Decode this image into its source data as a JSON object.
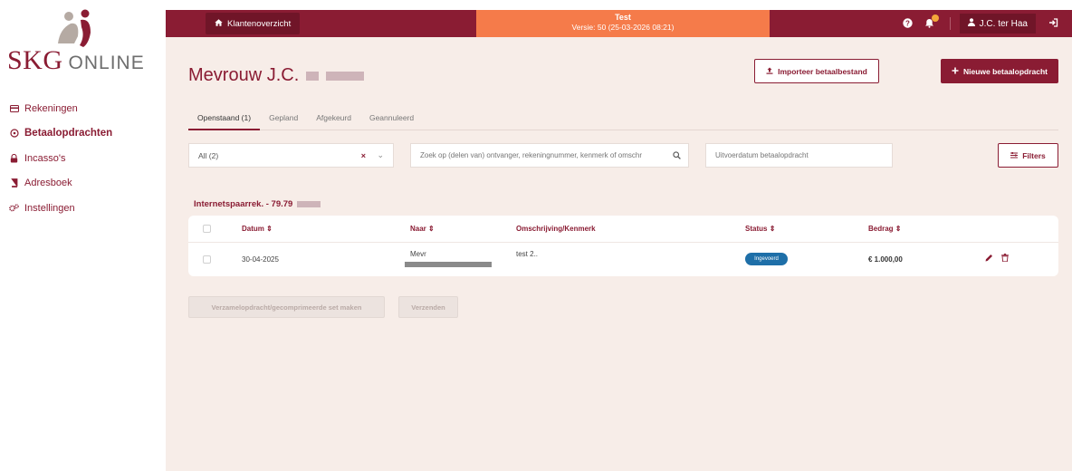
{
  "brand": {
    "name_main": "SKG",
    "name_sub": "ONLINE",
    "primary_color": "#8a1c33",
    "accent_color": "#f57b4a"
  },
  "sidebar": {
    "items": [
      {
        "label": "Rekeningen",
        "icon": "credit-card-icon",
        "active": false
      },
      {
        "label": "Betaalopdrachten",
        "icon": "circle-arrows-icon",
        "active": true
      },
      {
        "label": "Incasso's",
        "icon": "lock-icon",
        "active": false
      },
      {
        "label": "Adresboek",
        "icon": "book-icon",
        "active": false
      },
      {
        "label": "Instellingen",
        "icon": "gears-icon",
        "active": false
      }
    ]
  },
  "topbar": {
    "klantenoverzicht": "Klantenoverzicht",
    "env_title": "Test",
    "env_version": "Versie: 50 (25-03-2026 08:21)",
    "user": "J.C. ter Haa"
  },
  "page": {
    "title": "Mevrouw J.C.",
    "import_button": "Importeer betaalbestand",
    "new_button": "Nieuwe betaalopdracht"
  },
  "tabs": [
    {
      "label": "Openstaand (1)",
      "active": true
    },
    {
      "label": "Gepland",
      "active": false
    },
    {
      "label": "Afgekeurd",
      "active": false
    },
    {
      "label": "Geannuleerd",
      "active": false
    }
  ],
  "filters": {
    "account_select": "All (2)",
    "search_placeholder": "Zoek op (delen van) ontvanger, rekeningnummer, kenmerk of omschr",
    "date_placeholder": "Uitvoerdatum betaalopdracht",
    "filters_button": "Filters"
  },
  "group": {
    "title": "Internetspaarrek. - 79.79"
  },
  "table": {
    "columns": [
      "Datum",
      "Naar",
      "Omschrijving/Kenmerk",
      "Status",
      "Bedrag"
    ],
    "rows": [
      {
        "datum": "30-04-2025",
        "naar": "Mevr",
        "omschrijving": "test 2..",
        "status": "Ingevoerd",
        "bedrag": "€ 1.000,00"
      }
    ]
  },
  "actions": {
    "verzamel_button": "Verzamelopdracht/gecomprimeerde set maken",
    "verzenden_button": "Verzenden"
  }
}
